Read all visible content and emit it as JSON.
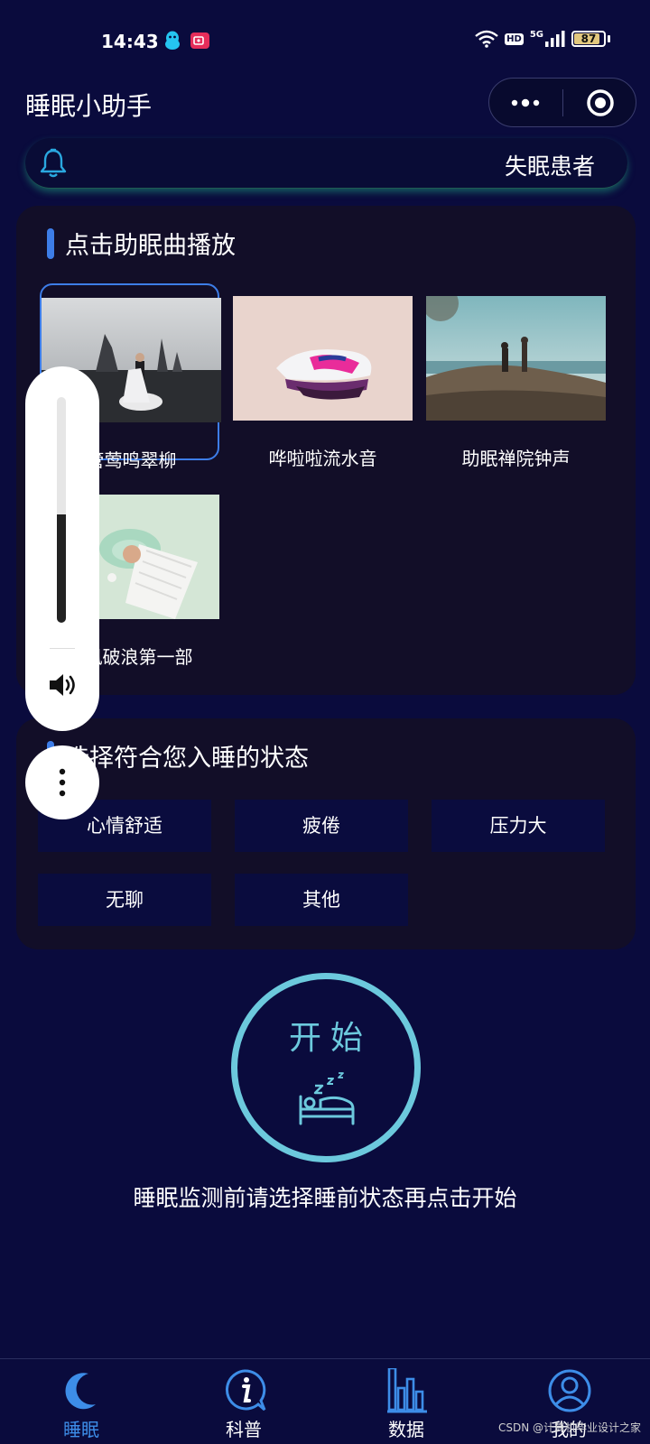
{
  "status_bar": {
    "time": "14:43",
    "network": "5G",
    "hd": "HD",
    "battery": "87",
    "battery_level": 0.87
  },
  "app": {
    "title": "睡眠小助手"
  },
  "notice": {
    "role": "失眠患者"
  },
  "music": {
    "title": "点击助眠曲播放",
    "tracks": [
      {
        "label": "管莺鸣翠柳"
      },
      {
        "label": "哗啦啦流水音"
      },
      {
        "label": "助眠禅院钟声"
      },
      {
        "label": "乘风破浪第一部"
      }
    ]
  },
  "volume": {
    "level": 0.48
  },
  "state": {
    "title": "选择符合您入睡的状态",
    "options": [
      "心情舒适",
      "疲倦",
      "压力大",
      "无聊",
      "其他"
    ]
  },
  "start": {
    "label": "开始",
    "hint": "睡眠监测前请选择睡前状态再点击开始"
  },
  "tabbar": {
    "items": [
      "睡眠",
      "科普",
      "数据",
      "我的"
    ],
    "active_color": "#3d8de8"
  },
  "watermark": "CSDN @计算机毕业设计之家"
}
